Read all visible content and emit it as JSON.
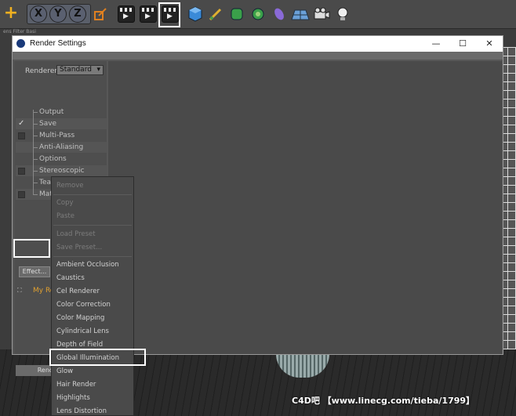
{
  "toolbar": {
    "axis_x": "X",
    "axis_y": "Y",
    "axis_z": "Z",
    "icons": [
      "add-icon",
      "axis-x-icon",
      "axis-y-icon",
      "axis-z-icon",
      "coordinate-system-icon",
      "render-view-icon",
      "render-picture-viewer-icon",
      "edit-render-settings-icon",
      "cube-icon",
      "pen-icon",
      "subdivision-icon",
      "mograph-icon",
      "deformer-icon",
      "floor-icon",
      "camera-icon",
      "light-icon"
    ]
  },
  "background_tabs": "ens Filter  Basi",
  "window": {
    "title": "Render Settings",
    "minimize": "—",
    "maximize": "☐",
    "close": "✕"
  },
  "renderer": {
    "label": "Renderer",
    "value": "Standard"
  },
  "tree": [
    {
      "label": "Output",
      "checked": false,
      "has_checkbox": false
    },
    {
      "label": "Save",
      "checked": true,
      "has_checkbox": true
    },
    {
      "label": "Multi-Pass",
      "checked": false,
      "has_checkbox": true
    },
    {
      "label": "Anti-Aliasing",
      "checked": false,
      "has_checkbox": false
    },
    {
      "label": "Options",
      "checked": false,
      "has_checkbox": false
    },
    {
      "label": "Stereoscopic",
      "checked": false,
      "has_checkbox": true
    },
    {
      "label": "Team Render",
      "checked": false,
      "has_checkbox": false
    },
    {
      "label": "Material Override",
      "checked": false,
      "has_checkbox": true
    }
  ],
  "effect_button": "Effect...",
  "render_setting_name": "My Re",
  "render_button": "Rend",
  "context_menu": {
    "groups": [
      [
        {
          "label": "Remove",
          "disabled": true
        }
      ],
      [
        {
          "label": "Copy",
          "disabled": true
        },
        {
          "label": "Paste",
          "disabled": true
        }
      ],
      [
        {
          "label": "Load Preset",
          "disabled": true
        },
        {
          "label": "Save Preset...",
          "disabled": true
        }
      ],
      [
        {
          "label": "Ambient Occlusion",
          "disabled": false
        },
        {
          "label": "Caustics",
          "disabled": false
        },
        {
          "label": "Cel Renderer",
          "disabled": false
        },
        {
          "label": "Color Correction",
          "disabled": false
        },
        {
          "label": "Color Mapping",
          "disabled": false
        },
        {
          "label": "Cylindrical Lens",
          "disabled": false
        },
        {
          "label": "Depth of Field",
          "disabled": false
        },
        {
          "label": "Global Illumination",
          "disabled": false,
          "highlighted": true
        },
        {
          "label": "Glow",
          "disabled": false
        },
        {
          "label": "Hair Render",
          "disabled": false
        },
        {
          "label": "Highlights",
          "disabled": false
        },
        {
          "label": "Lens Distortion",
          "disabled": false
        }
      ]
    ]
  },
  "watermark": "C4D吧 【www.linecg.com/tieba/1799】",
  "colors": {
    "window_bg": "#575757",
    "panel_bg": "#4a4a4a",
    "highlight_border": "#ffffff",
    "render_setting_name": "#e0a030"
  }
}
